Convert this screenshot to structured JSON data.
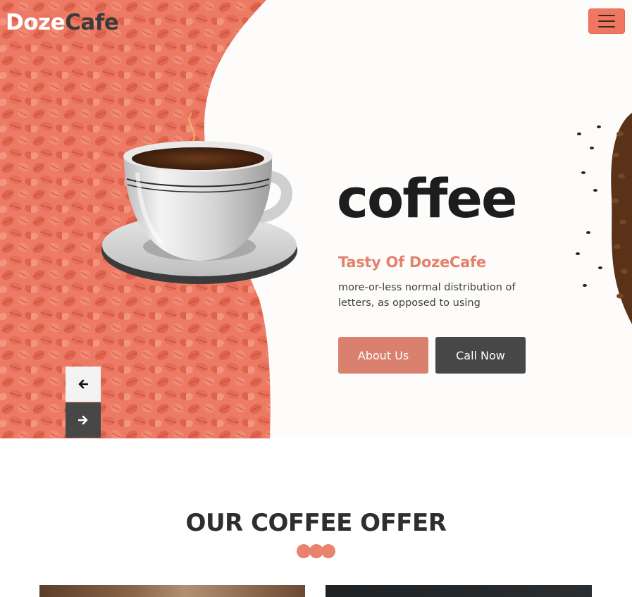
{
  "brand": {
    "name_part1": "Doze",
    "name_part2": "Cafe"
  },
  "header": {
    "menu_icon": "hamburger-menu-icon"
  },
  "hero": {
    "headline": "coffee",
    "subtitle": "Tasty Of DozeCafe",
    "description": "more-or-less normal distribution of letters, as opposed to using",
    "about_button": "About Us",
    "call_button": "Call Now",
    "prev_icon": "arrow-left-icon",
    "next_icon": "arrow-right-icon"
  },
  "offer": {
    "title": "OUR COFFEE OFFER"
  },
  "colors": {
    "accent": "#ef775f",
    "accent_muted": "#d9806e",
    "dark": "#474747",
    "headline": "#1d1d1d"
  }
}
